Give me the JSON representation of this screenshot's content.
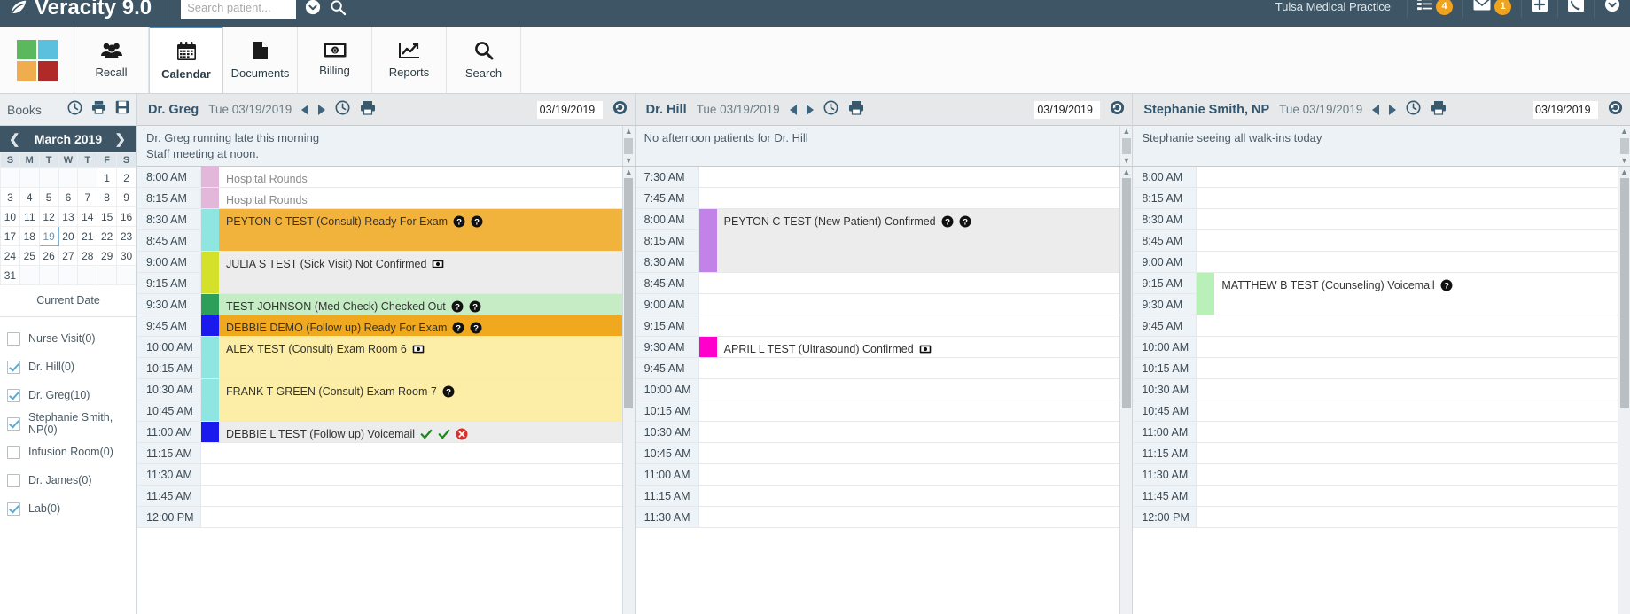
{
  "header": {
    "app_title": "Veracity 9.0",
    "logo_icon": "leaf-icon",
    "search_placeholder": "Search patient...",
    "search_value": "",
    "dropdown_icon": "chevron-circle-down-icon",
    "search_icon": "search-icon",
    "practice_name": "Tulsa Medical Practice",
    "tasks_badge": "4",
    "messages_badge": "1",
    "tasks_icon": "tasks-list-icon",
    "mail_icon": "envelope-icon",
    "add_icon": "plus-square-icon",
    "phone_icon": "phone-square-icon",
    "user_menu_icon": "chevron-circle-down-icon"
  },
  "nav": {
    "logo_icon": "four-squares-logo",
    "logo_colors": [
      "#5cb85c",
      "#5bc0de",
      "#f0ad4e",
      "#b12a2a"
    ],
    "tabs": [
      {
        "label": "Recall",
        "icon": "users-icon",
        "active": false
      },
      {
        "label": "Calendar",
        "icon": "calendar-icon",
        "active": true
      },
      {
        "label": "Documents",
        "icon": "document-icon",
        "active": false
      },
      {
        "label": "Billing",
        "icon": "money-bill-icon",
        "active": false
      },
      {
        "label": "Reports",
        "icon": "chart-line-icon",
        "active": false
      },
      {
        "label": "Search",
        "icon": "search-icon",
        "active": false
      }
    ]
  },
  "sidebar": {
    "books_label": "Books",
    "books_icons": [
      "clock-icon",
      "printer-icon",
      "save-icon"
    ],
    "minical": {
      "month_label": "March 2019",
      "prev_icon": "chevron-left-icon",
      "next_icon": "chevron-right-icon",
      "weekdays": [
        "S",
        "M",
        "T",
        "W",
        "T",
        "F",
        "S"
      ],
      "weeks": [
        [
          "",
          "",
          "",
          "",
          "",
          "1",
          "2"
        ],
        [
          "3",
          "4",
          "5",
          "6",
          "7",
          "8",
          "9"
        ],
        [
          "10",
          "11",
          "12",
          "13",
          "14",
          "15",
          "16"
        ],
        [
          "17",
          "18",
          "19",
          "20",
          "21",
          "22",
          "23"
        ],
        [
          "24",
          "25",
          "26",
          "27",
          "28",
          "29",
          "30"
        ],
        [
          "31",
          "",
          "",
          "",
          "",
          "",
          ""
        ]
      ],
      "selected_day": "19"
    },
    "current_date_label": "Current Date",
    "providers": [
      {
        "label": "Nurse Visit(0)",
        "checked": false
      },
      {
        "label": "Dr. Hill(0)",
        "checked": true
      },
      {
        "label": "Dr. Greg(10)",
        "checked": true
      },
      {
        "label": "Stephanie Smith, NP(0)",
        "checked": true
      },
      {
        "label": "Infusion Room(0)",
        "checked": false
      },
      {
        "label": "Dr. James(0)",
        "checked": false
      },
      {
        "label": "Lab(0)",
        "checked": true
      }
    ]
  },
  "columns": [
    {
      "provider": "Dr. Greg",
      "date_label": "Tue 03/19/2019",
      "date_value": "03/19/2019",
      "prev_icon": "triangle-left-icon",
      "next_icon": "triangle-right-icon",
      "clock_icon": "clock-icon",
      "print_icon": "printer-icon",
      "refresh_icon": "refresh-circle-icon",
      "notes": [
        "Dr. Greg running late this morning",
        "Staff meeting at noon."
      ],
      "start_time": "8:00 AM",
      "times": [
        "8:00 AM",
        "8:15 AM",
        "8:30 AM",
        "8:45 AM",
        "9:00 AM",
        "9:15 AM",
        "9:30 AM",
        "9:45 AM",
        "10:00 AM",
        "10:15 AM",
        "10:30 AM",
        "10:45 AM",
        "11:00 AM",
        "11:15 AM",
        "11:30 AM",
        "11:45 AM",
        "12:00 PM"
      ],
      "appointments": [
        {
          "text": "Hospital Rounds",
          "slot": 0,
          "span": 1,
          "bar_color": "#e3b7da",
          "bg_color": "#ffffff",
          "text_color": "#8b8b8b",
          "icons": []
        },
        {
          "text": "Hospital Rounds",
          "slot": 1,
          "span": 1,
          "bar_color": "#e3b7da",
          "bg_color": "#ffffff",
          "text_color": "#8b8b8b",
          "icons": []
        },
        {
          "text": "PEYTON C TEST (Consult) Ready For Exam",
          "slot": 2,
          "span": 2,
          "bar_color": "#8fe6e0",
          "bg_color": "#f2b33d",
          "text_color": "#333333",
          "icons": [
            "question-circle-icon",
            "question-circle-icon"
          ]
        },
        {
          "text": "JULIA S TEST (Sick Visit) Not Confirmed",
          "slot": 4,
          "span": 2,
          "bar_color": "#d4e029",
          "bg_color": "#ececec",
          "text_color": "#333333",
          "icons": [
            "money-icon"
          ]
        },
        {
          "text": "TEST JOHNSON (Med Check) Checked Out",
          "slot": 6,
          "span": 1,
          "bar_color": "#2e9e5b",
          "bg_color": "#c6ecc6",
          "text_color": "#333333",
          "icons": [
            "question-circle-icon",
            "question-circle-icon"
          ]
        },
        {
          "text": "DEBBIE DEMO (Follow up) Ready For Exam",
          "slot": 7,
          "span": 1,
          "bar_color": "#1a1aee",
          "bg_color": "#f0a81e",
          "text_color": "#333333",
          "icons": [
            "question-circle-icon",
            "question-circle-icon"
          ]
        },
        {
          "text": "ALEX TEST (Consult) Exam Room 6",
          "slot": 8,
          "span": 2,
          "bar_color": "#8fe6e0",
          "bg_color": "#fceea7",
          "text_color": "#333333",
          "icons": [
            "money-icon"
          ]
        },
        {
          "text": "FRANK T GREEN (Consult) Exam Room 7",
          "slot": 10,
          "span": 2,
          "bar_color": "#8fe6e0",
          "bg_color": "#fceea7",
          "text_color": "#333333",
          "icons": [
            "question-circle-icon"
          ]
        },
        {
          "text": "DEBBIE L TEST (Follow up) Voicemail",
          "slot": 12,
          "span": 1,
          "bar_color": "#1a1aee",
          "bg_color": "#ececec",
          "text_color": "#333333",
          "icons": [
            "check-icon",
            "check-icon",
            "x-circle-icon"
          ]
        }
      ]
    },
    {
      "provider": "Dr. Hill",
      "date_label": "Tue 03/19/2019",
      "date_value": "03/19/2019",
      "prev_icon": "triangle-left-icon",
      "next_icon": "triangle-right-icon",
      "clock_icon": "clock-icon",
      "print_icon": "printer-icon",
      "refresh_icon": "refresh-circle-icon",
      "notes": [
        "No afternoon patients for Dr. Hill"
      ],
      "start_time": "7:30 AM",
      "times": [
        "7:30 AM",
        "7:45 AM",
        "8:00 AM",
        "8:15 AM",
        "8:30 AM",
        "8:45 AM",
        "9:00 AM",
        "9:15 AM",
        "9:30 AM",
        "9:45 AM",
        "10:00 AM",
        "10:15 AM",
        "10:30 AM",
        "10:45 AM",
        "11:00 AM",
        "11:15 AM",
        "11:30 AM"
      ],
      "appointments": [
        {
          "text": "PEYTON C TEST (New Patient) Confirmed",
          "slot": 2,
          "span": 3,
          "bar_color": "#c183e8",
          "bg_color": "#ececec",
          "text_color": "#333333",
          "icons": [
            "question-circle-icon",
            "question-circle-icon"
          ]
        },
        {
          "text": "APRIL L TEST (Ultrasound) Confirmed",
          "slot": 8,
          "span": 1,
          "bar_color": "#ff00cc",
          "bg_color": "#ffffff",
          "text_color": "#333333",
          "icons": [
            "money-icon"
          ]
        }
      ]
    },
    {
      "provider": "Stephanie Smith, NP",
      "date_label": "Tue 03/19/2019",
      "date_value": "03/19/2019",
      "prev_icon": "triangle-left-icon",
      "next_icon": "triangle-right-icon",
      "clock_icon": "clock-icon",
      "print_icon": "printer-icon",
      "refresh_icon": "refresh-circle-icon",
      "notes": [
        "Stephanie seeing all walk-ins today"
      ],
      "start_time": "8:00 AM",
      "times": [
        "8:00 AM",
        "8:15 AM",
        "8:30 AM",
        "8:45 AM",
        "9:00 AM",
        "9:15 AM",
        "9:30 AM",
        "9:45 AM",
        "10:00 AM",
        "10:15 AM",
        "10:30 AM",
        "10:45 AM",
        "11:00 AM",
        "11:15 AM",
        "11:30 AM",
        "11:45 AM",
        "12:00 PM"
      ],
      "appointments": [
        {
          "text": "MATTHEW B TEST (Counseling) Voicemail",
          "slot": 5,
          "span": 2,
          "bar_color": "#b9f0b9",
          "bg_color": "#ffffff",
          "text_color": "#333333",
          "icons": [
            "question-circle-icon"
          ]
        }
      ]
    }
  ]
}
